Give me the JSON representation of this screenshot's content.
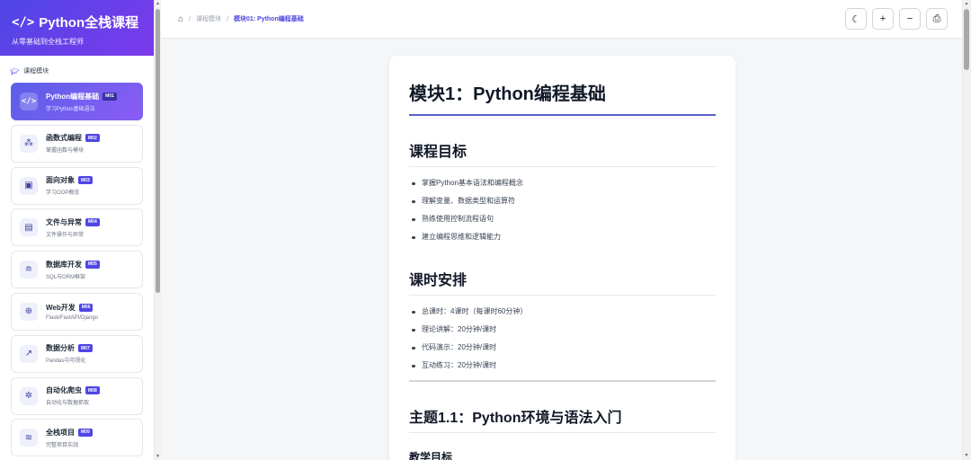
{
  "brand": {
    "icon": "</>",
    "title": "Python全栈课程",
    "subtitle": "从零基础到全栈工程师"
  },
  "sidebar": {
    "section_label": "课程模块",
    "section_icon": "graduation-cap-icon",
    "modules": [
      {
        "title": "Python编程基础",
        "code": "M01",
        "desc": "学习Python基础语法",
        "icon": "code-icon",
        "glyph": "</>"
      },
      {
        "title": "函数式编程",
        "code": "M02",
        "desc": "掌握函数与模块",
        "icon": "cubes-icon",
        "glyph": "⁂"
      },
      {
        "title": "面向对象",
        "code": "M03",
        "desc": "学习OOP概念",
        "icon": "object-group-icon",
        "glyph": "▣"
      },
      {
        "title": "文件与异常",
        "code": "M04",
        "desc": "文件操作与异常",
        "icon": "file-icon",
        "glyph": "▤"
      },
      {
        "title": "数据库开发",
        "code": "M05",
        "desc": "SQL与ORM框架",
        "icon": "database-icon",
        "glyph": "≘"
      },
      {
        "title": "Web开发",
        "code": "M06",
        "desc": "Flask/FastAPI/Django",
        "icon": "globe-icon",
        "glyph": "⊕"
      },
      {
        "title": "数据分析",
        "code": "M07",
        "desc": "Pandas与可视化",
        "icon": "chart-line-icon",
        "glyph": "↗"
      },
      {
        "title": "自动化爬虫",
        "code": "M08",
        "desc": "自动化与数据抓取",
        "icon": "spider-icon",
        "glyph": "✲"
      },
      {
        "title": "全栈项目",
        "code": "M09",
        "desc": "完整项目实战",
        "icon": "layers-icon",
        "glyph": "≋"
      }
    ]
  },
  "breadcrumb": {
    "home_icon": "home-icon",
    "home_glyph": "⌂",
    "parent": "课程模块",
    "sep": "/",
    "current": "模块01: Python编程基础"
  },
  "toolbar": [
    {
      "name": "theme-toggle-button",
      "icon": "moon-icon",
      "glyph": "☾"
    },
    {
      "name": "zoom-in-button",
      "icon": "plus-icon",
      "glyph": "+"
    },
    {
      "name": "zoom-out-button",
      "icon": "minus-icon",
      "glyph": "−"
    },
    {
      "name": "print-button",
      "icon": "print-icon",
      "glyph": "⎙"
    }
  ],
  "content": {
    "title": "模块1：Python编程基础",
    "goals_heading": "课程目标",
    "goals": [
      "掌握Python基本语法和编程概念",
      "理解变量、数据类型和运算符",
      "熟练使用控制流程语句",
      "建立编程思维和逻辑能力"
    ],
    "schedule_heading": "课时安排",
    "schedule": [
      "总课时：4课时（每课时60分钟）",
      "理论讲解：20分钟/课时",
      "代码演示：20分钟/课时",
      "互动练习：20分钟/课时"
    ],
    "topic_heading": "主题1.1：Python环境与语法入门",
    "teaching_goals_heading": "教学目标"
  },
  "colors": {
    "accent": "#4f46e5",
    "accent2": "#7c3aed"
  }
}
